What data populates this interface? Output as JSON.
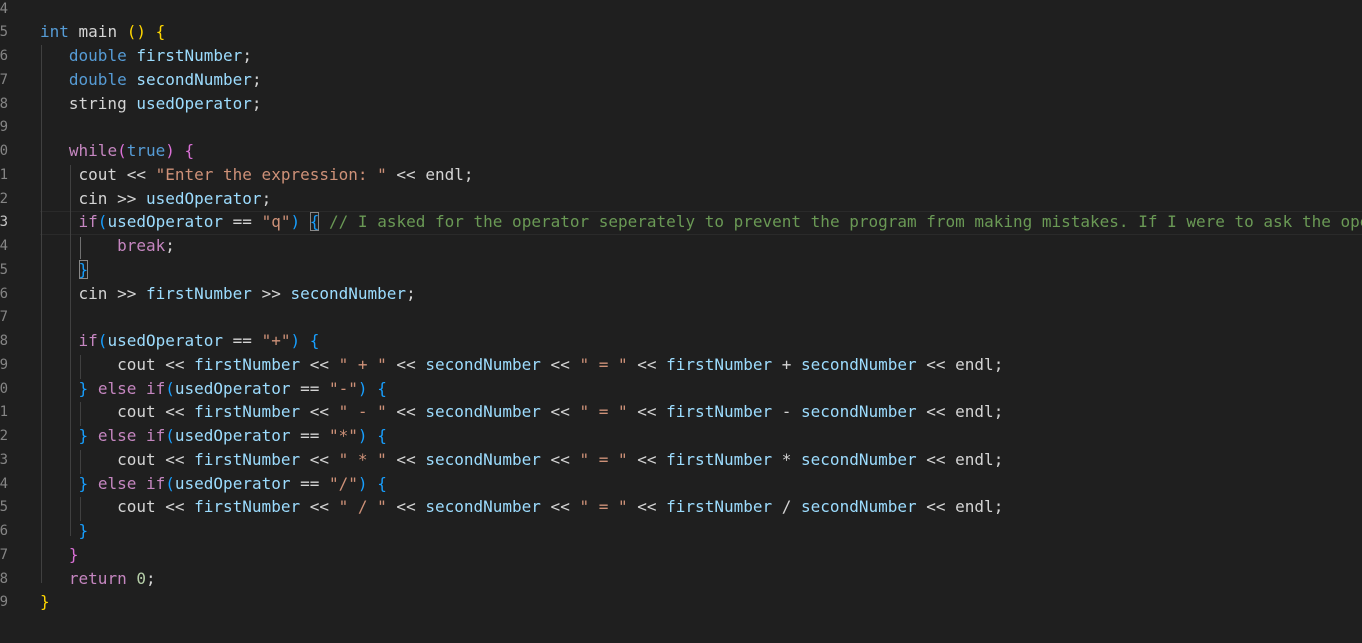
{
  "editor": {
    "line_numbers": [
      "4",
      "5",
      "6",
      "7",
      "8",
      "9",
      "0",
      "1",
      "2",
      "3",
      "4",
      "5",
      "6",
      "7",
      "8",
      "9",
      "0",
      "1",
      "2",
      "3",
      "4",
      "5",
      "6",
      "7",
      "8",
      "9"
    ],
    "lines": [
      [],
      [
        {
          "t": "int",
          "c": "kw"
        },
        {
          "t": " main ",
          "c": "txt"
        },
        {
          "t": "()",
          "c": "b1"
        },
        {
          "t": " ",
          "c": "txt"
        },
        {
          "t": "{",
          "c": "b1"
        }
      ],
      [
        {
          "t": "   ",
          "c": "txt"
        },
        {
          "t": "double",
          "c": "kw"
        },
        {
          "t": " ",
          "c": "txt"
        },
        {
          "t": "firstNumber",
          "c": "var"
        },
        {
          "t": ";",
          "c": "txt"
        }
      ],
      [
        {
          "t": "   ",
          "c": "txt"
        },
        {
          "t": "double",
          "c": "kw"
        },
        {
          "t": " ",
          "c": "txt"
        },
        {
          "t": "secondNumber",
          "c": "var"
        },
        {
          "t": ";",
          "c": "txt"
        }
      ],
      [
        {
          "t": "   string ",
          "c": "txt"
        },
        {
          "t": "usedOperator",
          "c": "var"
        },
        {
          "t": ";",
          "c": "txt"
        }
      ],
      [],
      [
        {
          "t": "   ",
          "c": "txt"
        },
        {
          "t": "while",
          "c": "ctl"
        },
        {
          "t": "(",
          "c": "b2"
        },
        {
          "t": "true",
          "c": "kw"
        },
        {
          "t": ")",
          "c": "b2"
        },
        {
          "t": " ",
          "c": "txt"
        },
        {
          "t": "{",
          "c": "b2"
        }
      ],
      [
        {
          "t": "    cout << ",
          "c": "txt"
        },
        {
          "t": "\"Enter the expression: \"",
          "c": "str"
        },
        {
          "t": " << endl;",
          "c": "txt"
        }
      ],
      [
        {
          "t": "    cin >> ",
          "c": "txt"
        },
        {
          "t": "usedOperator",
          "c": "var"
        },
        {
          "t": ";",
          "c": "txt"
        }
      ],
      [
        {
          "t": "    ",
          "c": "txt"
        },
        {
          "t": "if",
          "c": "ctl"
        },
        {
          "t": "(",
          "c": "b3"
        },
        {
          "t": "usedOperator",
          "c": "var"
        },
        {
          "t": " == ",
          "c": "txt"
        },
        {
          "t": "\"q\"",
          "c": "str"
        },
        {
          "t": ")",
          "c": "b3"
        },
        {
          "t": " ",
          "c": "txt"
        },
        {
          "t": "{",
          "c": "b3",
          "m": true
        },
        {
          "t": " ",
          "c": "txt"
        },
        {
          "t": "// I asked for the operator seperately to prevent the program from making mistakes. If I were to ask the operator together with the numbers",
          "c": "cmt"
        }
      ],
      [
        {
          "t": "        ",
          "c": "txt"
        },
        {
          "t": "break",
          "c": "ctl"
        },
        {
          "t": ";",
          "c": "txt"
        }
      ],
      [
        {
          "t": "    ",
          "c": "txt"
        },
        {
          "t": "}",
          "c": "b3",
          "m": true
        }
      ],
      [
        {
          "t": "    cin >> ",
          "c": "txt"
        },
        {
          "t": "firstNumber",
          "c": "var"
        },
        {
          "t": " >> ",
          "c": "txt"
        },
        {
          "t": "secondNumber",
          "c": "var"
        },
        {
          "t": ";",
          "c": "txt"
        }
      ],
      [],
      [
        {
          "t": "    ",
          "c": "txt"
        },
        {
          "t": "if",
          "c": "ctl"
        },
        {
          "t": "(",
          "c": "b3"
        },
        {
          "t": "usedOperator",
          "c": "var"
        },
        {
          "t": " == ",
          "c": "txt"
        },
        {
          "t": "\"+\"",
          "c": "str"
        },
        {
          "t": ")",
          "c": "b3"
        },
        {
          "t": " ",
          "c": "txt"
        },
        {
          "t": "{",
          "c": "b3"
        }
      ],
      [
        {
          "t": "        cout << ",
          "c": "txt"
        },
        {
          "t": "firstNumber",
          "c": "var"
        },
        {
          "t": " << ",
          "c": "txt"
        },
        {
          "t": "\" + \"",
          "c": "str"
        },
        {
          "t": " << ",
          "c": "txt"
        },
        {
          "t": "secondNumber",
          "c": "var"
        },
        {
          "t": " << ",
          "c": "txt"
        },
        {
          "t": "\" = \"",
          "c": "str"
        },
        {
          "t": " << ",
          "c": "txt"
        },
        {
          "t": "firstNumber",
          "c": "var"
        },
        {
          "t": " + ",
          "c": "txt"
        },
        {
          "t": "secondNumber",
          "c": "var"
        },
        {
          "t": " << endl;",
          "c": "txt"
        }
      ],
      [
        {
          "t": "    ",
          "c": "txt"
        },
        {
          "t": "}",
          "c": "b3"
        },
        {
          "t": " ",
          "c": "txt"
        },
        {
          "t": "else",
          "c": "ctl"
        },
        {
          "t": " ",
          "c": "txt"
        },
        {
          "t": "if",
          "c": "ctl"
        },
        {
          "t": "(",
          "c": "b3"
        },
        {
          "t": "usedOperator",
          "c": "var"
        },
        {
          "t": " == ",
          "c": "txt"
        },
        {
          "t": "\"-\"",
          "c": "str"
        },
        {
          "t": ")",
          "c": "b3"
        },
        {
          "t": " ",
          "c": "txt"
        },
        {
          "t": "{",
          "c": "b3"
        }
      ],
      [
        {
          "t": "        cout << ",
          "c": "txt"
        },
        {
          "t": "firstNumber",
          "c": "var"
        },
        {
          "t": " << ",
          "c": "txt"
        },
        {
          "t": "\" - \"",
          "c": "str"
        },
        {
          "t": " << ",
          "c": "txt"
        },
        {
          "t": "secondNumber",
          "c": "var"
        },
        {
          "t": " << ",
          "c": "txt"
        },
        {
          "t": "\" = \"",
          "c": "str"
        },
        {
          "t": " << ",
          "c": "txt"
        },
        {
          "t": "firstNumber",
          "c": "var"
        },
        {
          "t": " - ",
          "c": "txt"
        },
        {
          "t": "secondNumber",
          "c": "var"
        },
        {
          "t": " << endl;",
          "c": "txt"
        }
      ],
      [
        {
          "t": "    ",
          "c": "txt"
        },
        {
          "t": "}",
          "c": "b3"
        },
        {
          "t": " ",
          "c": "txt"
        },
        {
          "t": "else",
          "c": "ctl"
        },
        {
          "t": " ",
          "c": "txt"
        },
        {
          "t": "if",
          "c": "ctl"
        },
        {
          "t": "(",
          "c": "b3"
        },
        {
          "t": "usedOperator",
          "c": "var"
        },
        {
          "t": " == ",
          "c": "txt"
        },
        {
          "t": "\"*\"",
          "c": "str"
        },
        {
          "t": ")",
          "c": "b3"
        },
        {
          "t": " ",
          "c": "txt"
        },
        {
          "t": "{",
          "c": "b3"
        }
      ],
      [
        {
          "t": "        cout << ",
          "c": "txt"
        },
        {
          "t": "firstNumber",
          "c": "var"
        },
        {
          "t": " << ",
          "c": "txt"
        },
        {
          "t": "\" * \"",
          "c": "str"
        },
        {
          "t": " << ",
          "c": "txt"
        },
        {
          "t": "secondNumber",
          "c": "var"
        },
        {
          "t": " << ",
          "c": "txt"
        },
        {
          "t": "\" = \"",
          "c": "str"
        },
        {
          "t": " << ",
          "c": "txt"
        },
        {
          "t": "firstNumber",
          "c": "var"
        },
        {
          "t": " * ",
          "c": "txt"
        },
        {
          "t": "secondNumber",
          "c": "var"
        },
        {
          "t": " << endl;",
          "c": "txt"
        }
      ],
      [
        {
          "t": "    ",
          "c": "txt"
        },
        {
          "t": "}",
          "c": "b3"
        },
        {
          "t": " ",
          "c": "txt"
        },
        {
          "t": "else",
          "c": "ctl"
        },
        {
          "t": " ",
          "c": "txt"
        },
        {
          "t": "if",
          "c": "ctl"
        },
        {
          "t": "(",
          "c": "b3"
        },
        {
          "t": "usedOperator",
          "c": "var"
        },
        {
          "t": " == ",
          "c": "txt"
        },
        {
          "t": "\"/\"",
          "c": "str"
        },
        {
          "t": ")",
          "c": "b3"
        },
        {
          "t": " ",
          "c": "txt"
        },
        {
          "t": "{",
          "c": "b3"
        }
      ],
      [
        {
          "t": "        cout << ",
          "c": "txt"
        },
        {
          "t": "firstNumber",
          "c": "var"
        },
        {
          "t": " << ",
          "c": "txt"
        },
        {
          "t": "\" / \"",
          "c": "str"
        },
        {
          "t": " << ",
          "c": "txt"
        },
        {
          "t": "secondNumber",
          "c": "var"
        },
        {
          "t": " << ",
          "c": "txt"
        },
        {
          "t": "\" = \"",
          "c": "str"
        },
        {
          "t": " << ",
          "c": "txt"
        },
        {
          "t": "firstNumber",
          "c": "var"
        },
        {
          "t": " / ",
          "c": "txt"
        },
        {
          "t": "secondNumber",
          "c": "var"
        },
        {
          "t": " << endl;",
          "c": "txt"
        }
      ],
      [
        {
          "t": "    ",
          "c": "txt"
        },
        {
          "t": "}",
          "c": "b3"
        }
      ],
      [
        {
          "t": "   ",
          "c": "txt"
        },
        {
          "t": "}",
          "c": "b2"
        }
      ],
      [
        {
          "t": "   ",
          "c": "txt"
        },
        {
          "t": "return",
          "c": "ctl"
        },
        {
          "t": " ",
          "c": "txt"
        },
        {
          "t": "0",
          "c": "num"
        },
        {
          "t": ";",
          "c": "txt"
        }
      ],
      [
        {
          "t": "}",
          "c": "b1"
        }
      ]
    ],
    "active_line": 9,
    "colors": {
      "background": "#1f1f1f",
      "keyword": "#569cd6",
      "control": "#c586c0",
      "variable": "#9cdcfe",
      "string": "#ce9178",
      "comment": "#6a9955",
      "number": "#b5cea8",
      "bracket_1": "#ffd700",
      "bracket_2": "#da70d6",
      "bracket_3": "#179fff"
    }
  }
}
